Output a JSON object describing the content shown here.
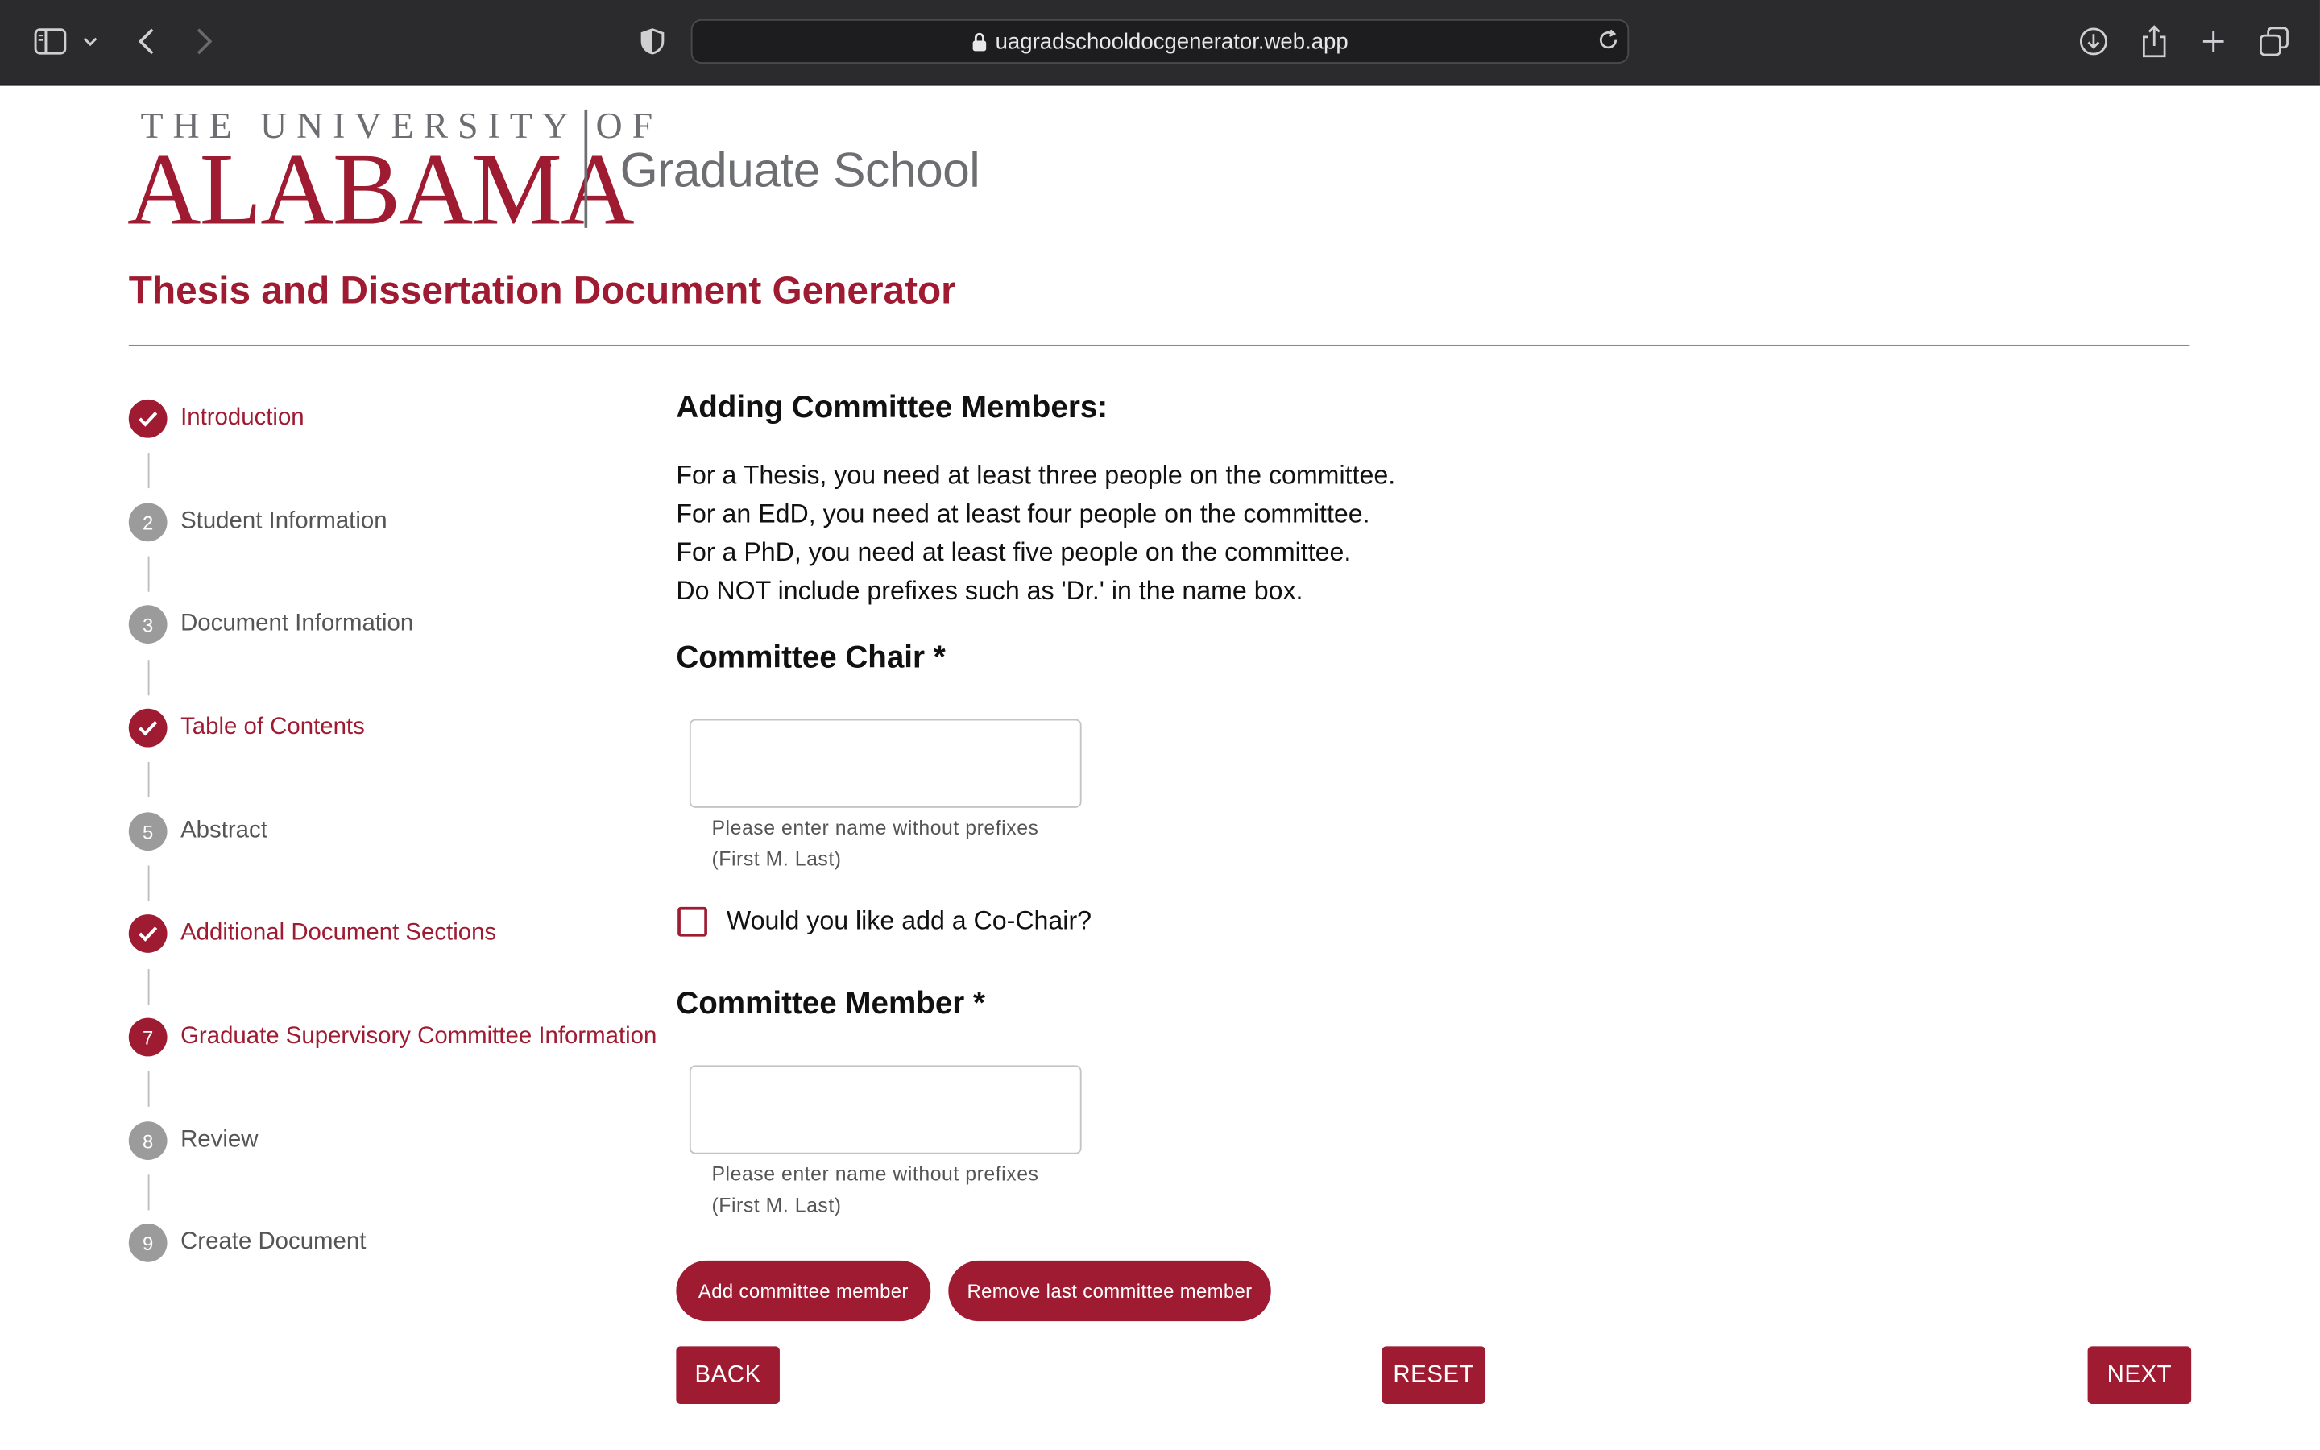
{
  "browser": {
    "url": "uagradschooldocgenerator.web.app"
  },
  "header": {
    "logo_top": "THE UNIVERSITY OF",
    "logo_main": "ALABAMA",
    "logo_reg": "®",
    "logo_sub": "Graduate School",
    "page_title": "Thesis and Dissertation Document Generator"
  },
  "steps": [
    {
      "marker": "",
      "label": "Introduction",
      "state": "done"
    },
    {
      "marker": "2",
      "label": "Student Information",
      "state": "pending"
    },
    {
      "marker": "3",
      "label": "Document Information",
      "state": "pending"
    },
    {
      "marker": "",
      "label": "Table of Contents",
      "state": "done"
    },
    {
      "marker": "5",
      "label": "Abstract",
      "state": "pending"
    },
    {
      "marker": "",
      "label": "Additional Document Sections",
      "state": "done"
    },
    {
      "marker": "7",
      "label": "Graduate Supervisory Committee Information",
      "state": "active"
    },
    {
      "marker": "8",
      "label": "Review",
      "state": "pending"
    },
    {
      "marker": "9",
      "label": "Create Document",
      "state": "pending"
    }
  ],
  "main": {
    "heading": "Adding Committee Members:",
    "instructions": [
      "For a Thesis, you need at least three people on the committee.",
      "For an EdD, you need at least four people on the committee.",
      "For a PhD, you need at least five people on the committee.",
      "Do NOT include prefixes such as 'Dr.' in the name box."
    ],
    "chair_heading": "Committee Chair *",
    "chair_value": "",
    "chair_helper_1": "Please enter name without prefixes",
    "chair_helper_2": "(First M. Last)",
    "cochair_label": "Would you like add a Co-Chair?",
    "member_heading": "Committee Member *",
    "member_value": "",
    "member_helper_1": "Please enter name without prefixes",
    "member_helper_2": "(First M. Last)",
    "add_member": "Add committee member",
    "remove_member": "Remove last committee member",
    "back": "BACK",
    "reset": "RESET",
    "next": "NEXT"
  },
  "colors": {
    "brand": "#9e1b32",
    "pending": "#9b9b9b"
  }
}
